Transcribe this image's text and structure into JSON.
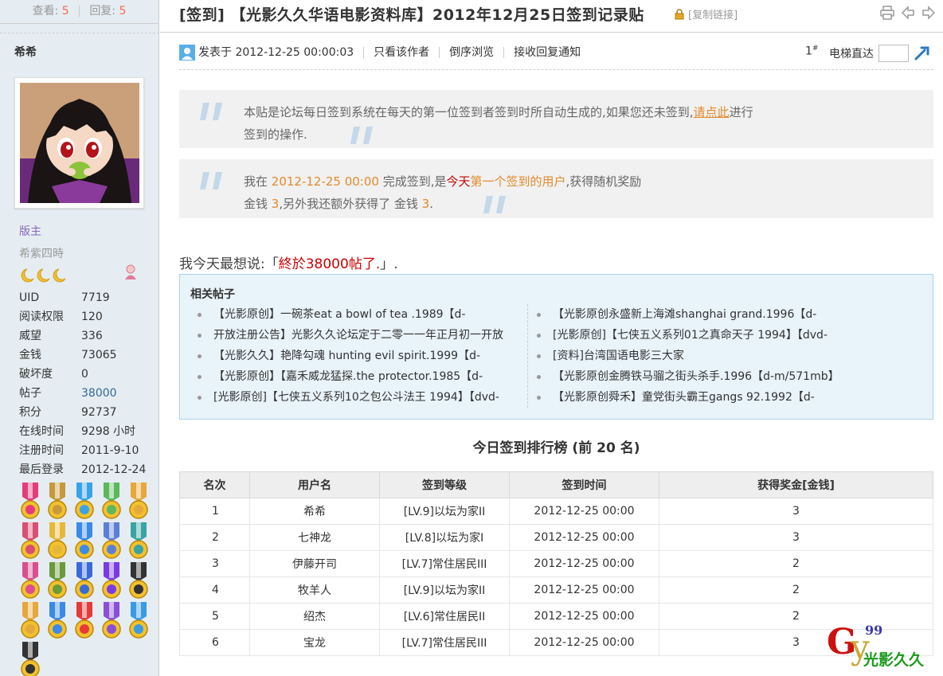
{
  "sidebar": {
    "stats": {
      "views_label": "查看:",
      "views": "5",
      "replies_label": "回复:",
      "replies": "5"
    },
    "username": "希希",
    "group": "版主",
    "custom_title": "希紫四時",
    "profile": [
      {
        "key": "UID",
        "value": "7719"
      },
      {
        "key": "阅读权限",
        "value": "120"
      },
      {
        "key": "威望",
        "value": "336"
      },
      {
        "key": "金钱",
        "value": "73065"
      },
      {
        "key": "破坏度",
        "value": "0"
      },
      {
        "key": "帖子",
        "value": "38000"
      },
      {
        "key": "积分",
        "value": "92737"
      },
      {
        "key": "在线时间",
        "value": "9298 小时"
      },
      {
        "key": "注册时间",
        "value": "2011-9-10"
      },
      {
        "key": "最后登录",
        "value": "2012-12-24"
      }
    ],
    "medal_colors": [
      "#e63b7a",
      "#c69a3a",
      "#3aa3e6",
      "#5cb85c",
      "#e6a83a",
      "#d94f70",
      "#e6b83a",
      "#3a8ae6",
      "#5b7fd6",
      "#3aa3a3",
      "#d94f90",
      "#6a9a3a",
      "#3a6ad6",
      "#7a3ae6",
      "#333333",
      "#e6a83a",
      "#3a8ae6",
      "#e63a3a",
      "#8a4fd6",
      "#3a9ae6",
      "#333333"
    ]
  },
  "thread": {
    "title": "[签到] 【光影久久华语电影资料库】2012年12月25日签到记录贴",
    "copy_link": "[复制链接]"
  },
  "post": {
    "posted_at": "发表于 2012-12-25 00:00:03",
    "only_author": "只看该作者",
    "reverse": "倒序浏览",
    "notify": "接收回复通知",
    "floor": "1",
    "floor_sup": "#",
    "elevator": "电梯直达"
  },
  "quote1": {
    "line1_pre": "本贴是论坛每日签到系统在每天的第一位签到者签到时所自动生成的,如果您还未签到,",
    "link": "请点此",
    "line1_post": "进行",
    "line2": "签到的操作."
  },
  "quote2": {
    "pre": "我在 ",
    "time": "2012-12-25 00:00",
    "mid": " 完成签到,是",
    "today": "今天",
    "first": "第一个签到的用户",
    "post": ",获得随机奖励",
    "l2_a": "金钱 ",
    "l2_b": "3",
    "l2_c": ",另外我还额外获得了 金钱 ",
    "l2_d": "3",
    "l2_e": "."
  },
  "want": {
    "pre": "我今天最想说:「",
    "text": "終於38000帖了.",
    "post": "」."
  },
  "related": {
    "title": "相关帖子",
    "left": [
      "【光影原创】一碗茶eat a bowl of tea .1989【d-",
      "开放注册公告】光影久久论坛定于二零一一年正月初一开放",
      "【光影久久】艳降勾魂 hunting evil spirit.1999【d-",
      "【光影原创】【嘉禾威龙猛探.the protector.1985【d-",
      "[光影原创]【七侠五义系列10之包公斗法王 1994】【dvd-"
    ],
    "right": [
      "【光影原创永盛新上海滩shanghai grand.1996【d-",
      "[光影原创]【七侠五义系列01之真命天子 1994】【dvd-",
      "[资料]台湾国语电影三大家",
      "【光影原创金腾铁马骝之街头杀手.1996【d-m/571mb】",
      "【光影原创舜禾】童党街头霸王gangs 92.1992【d-"
    ]
  },
  "rank": {
    "title": "今日签到排行榜 (前 20 名)",
    "headers": [
      "名次",
      "用户名",
      "签到等级",
      "签到时间",
      "获得奖金[金钱]"
    ],
    "rows": [
      [
        "1",
        "希希",
        "[LV.9]以坛为家II",
        "2012-12-25 00:00",
        "3"
      ],
      [
        "2",
        "七神龙",
        "[LV.8]以坛为家I",
        "2012-12-25 00:00",
        "3"
      ],
      [
        "3",
        "伊藤开司",
        "[LV.7]常住居民III",
        "2012-12-25 00:00",
        "2"
      ],
      [
        "4",
        "牧羊人",
        "[LV.9]以坛为家II",
        "2012-12-25 00:00",
        "2"
      ],
      [
        "5",
        "绍杰",
        "[LV.6]常住居民II",
        "2012-12-25 00:00",
        "2"
      ],
      [
        "6",
        "宝龙",
        "[LV.7]常住居民III",
        "2012-12-25 00:00",
        "3"
      ]
    ]
  },
  "watermark": {
    "g": "G",
    "y": "y",
    "num": "99",
    "text": "光影久久"
  }
}
